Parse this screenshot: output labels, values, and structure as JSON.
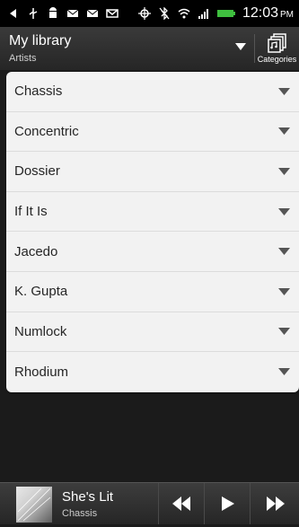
{
  "status_bar": {
    "time": "12:03",
    "ampm": "PM",
    "left_icons": [
      "back-icon",
      "usb-icon",
      "android-icon",
      "mail-icon",
      "mail-icon",
      "gmail-icon"
    ],
    "right_icons": [
      "gps-icon",
      "bluetooth-off-icon",
      "wifi-icon",
      "signal-icon",
      "battery-icon"
    ]
  },
  "header": {
    "title": "My library",
    "subtitle": "Artists",
    "categories_label": "Categories"
  },
  "artists": [
    {
      "label": "Chassis"
    },
    {
      "label": "Concentric"
    },
    {
      "label": "Dossier"
    },
    {
      "label": "If It Is"
    },
    {
      "label": "Jacedo"
    },
    {
      "label": "K. Gupta"
    },
    {
      "label": "Numlock"
    },
    {
      "label": "Rhodium"
    }
  ],
  "player": {
    "song_title": "She's Lit",
    "song_artist": "Chassis"
  },
  "colors": {
    "background": "#1b1b1b",
    "card": "#f2f2f2",
    "text_dark": "#262626",
    "battery": "#3fbf3f"
  }
}
